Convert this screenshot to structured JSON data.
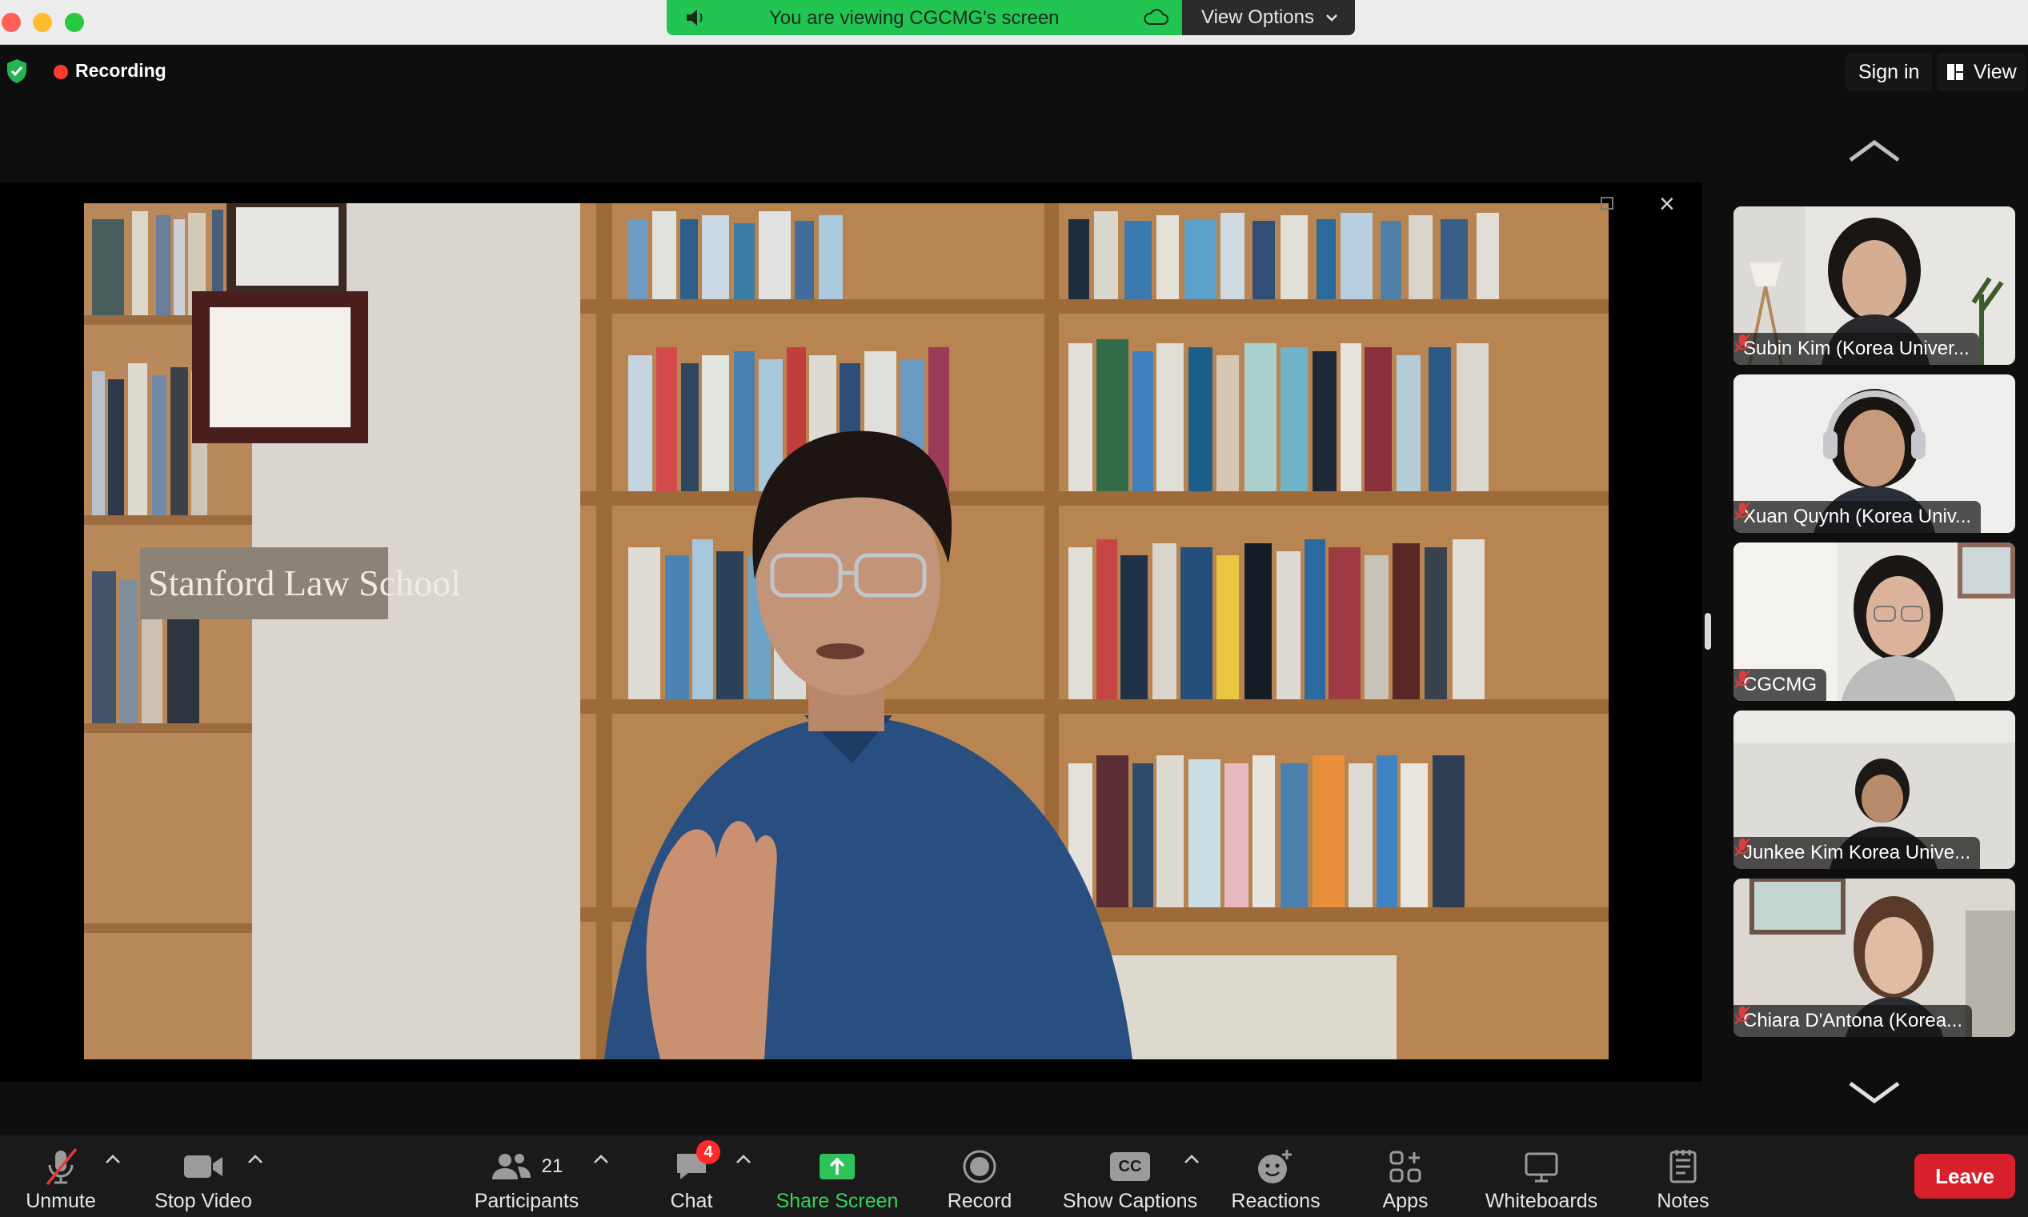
{
  "share_banner": {
    "text": "You are viewing CGCMG's screen",
    "view_options": "View Options"
  },
  "recording": {
    "label": "Recording"
  },
  "header": {
    "sign_in": "Sign in",
    "view": "View"
  },
  "video": {
    "sign_text": "Stanford Law School"
  },
  "participants_strip": [
    {
      "name": "Subin Kim (Korea Univer...",
      "active": false,
      "muted": true
    },
    {
      "name": "Xuan Quynh (Korea Univ...",
      "active": false,
      "muted": true
    },
    {
      "name": "CGCMG",
      "active": true,
      "muted": true
    },
    {
      "name": "Junkee Kim Korea Unive...",
      "active": false,
      "muted": true
    },
    {
      "name": "Chiara D'Antona (Korea...",
      "active": false,
      "muted": true
    }
  ],
  "toolbar": {
    "unmute": "Unmute",
    "stop_video": "Stop Video",
    "participants": "Participants",
    "participants_count": "21",
    "chat": "Chat",
    "chat_badge": "4",
    "share_screen": "Share Screen",
    "record": "Record",
    "show_captions": "Show Captions",
    "cc": "CC",
    "reactions": "Reactions",
    "apps": "Apps",
    "whiteboards": "Whiteboards",
    "notes": "Notes",
    "leave": "Leave"
  },
  "colors": {
    "accent_green": "#23c552",
    "leave_red": "#d7202c",
    "active_outline": "#2bd15e"
  }
}
